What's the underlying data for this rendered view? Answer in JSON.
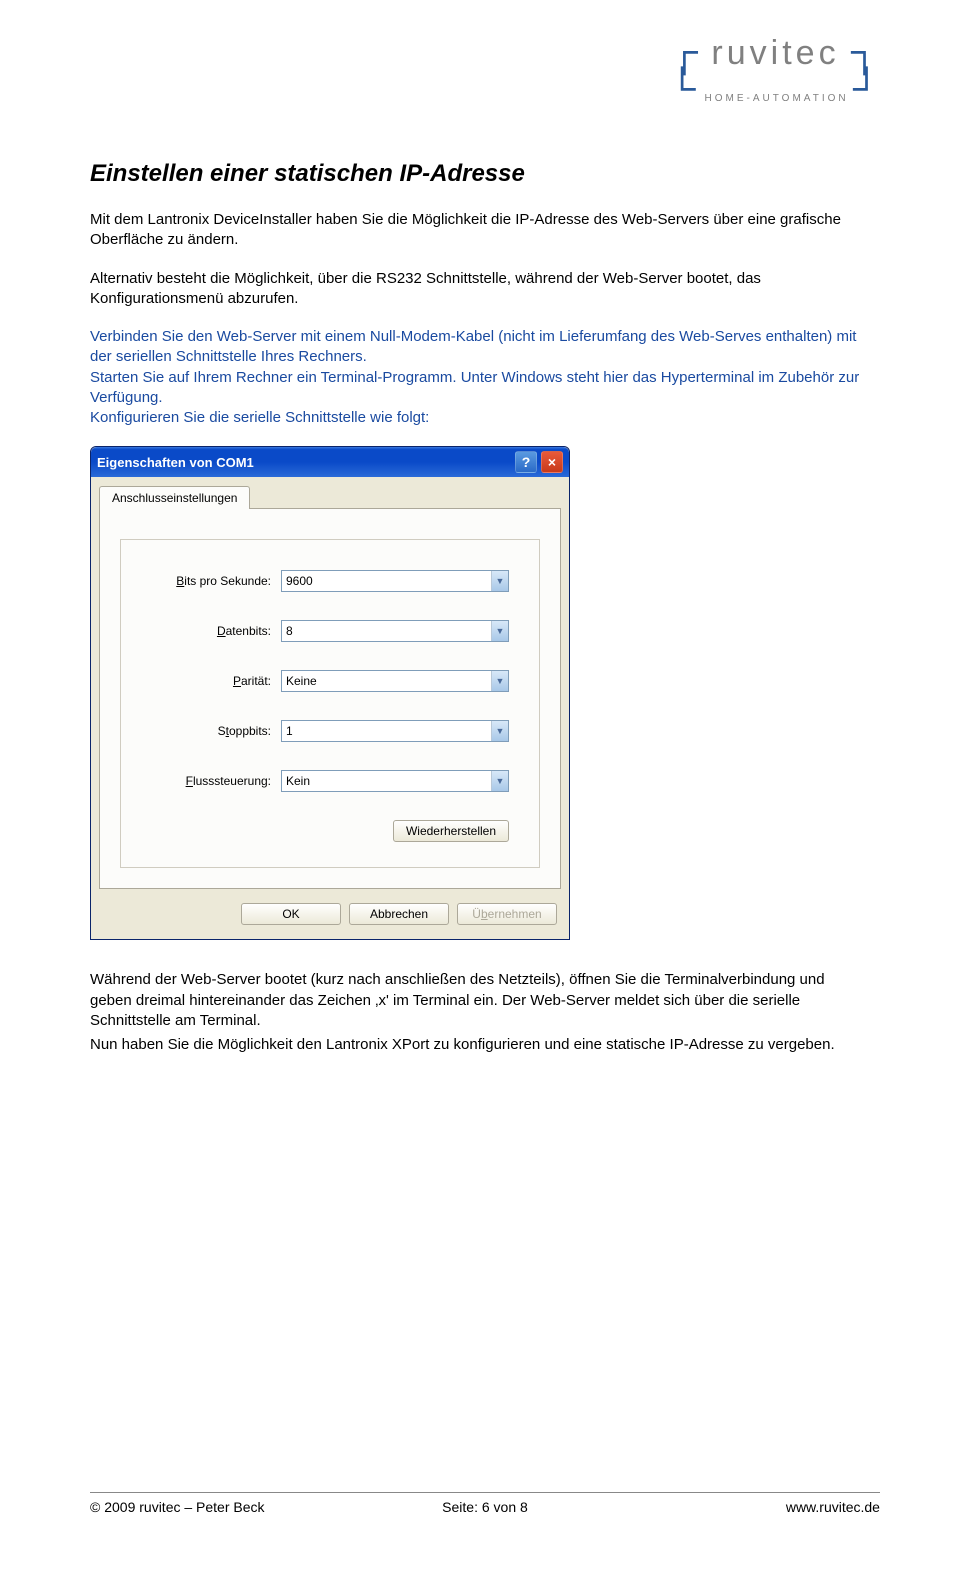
{
  "logo": {
    "name": "ruvitec",
    "tagline": "HOME-AUTOMATION"
  },
  "heading": "Einstellen einer statischen IP-Adresse",
  "para1": "Mit dem Lantronix DeviceInstaller haben Sie die Möglichkeit die IP-Adresse des Web-Servers über eine grafische Oberfläche zu ändern.",
  "para2": "Alternativ besteht die Möglichkeit, über die RS232 Schnittstelle, während der Web-Server bootet, das Konfigurationsmenü abzurufen.",
  "para3a": "Verbinden Sie den Web-Server mit einem Null-Modem-Kabel (nicht im Lieferumfang des Web-Serves enthalten) mit der seriellen Schnittstelle Ihres Rechners.",
  "para3b": "Starten Sie auf Ihrem Rechner ein Terminal-Programm. Unter Windows steht hier das Hyperterminal im Zubehör zur Verfügung.",
  "para3c": "Konfigurieren Sie die serielle Schnittstelle wie folgt:",
  "dialog": {
    "title": "Eigenschaften von COM1",
    "tab": "Anschlusseinstellungen",
    "fields": {
      "bits_label": "Bits pro Sekunde:",
      "bits_value": "9600",
      "datenbits_label": "Datenbits:",
      "datenbits_value": "8",
      "paritaet_label": "Parität:",
      "paritaet_value": "Keine",
      "stoppbits_label": "Stoppbits:",
      "stoppbits_value": "1",
      "fluss_label": "Flusssteuerung:",
      "fluss_value": "Kein"
    },
    "restore": "Wiederherstellen",
    "ok": "OK",
    "cancel": "Abbrechen",
    "apply": "Übernehmen"
  },
  "para4": "Während der Web-Server bootet (kurz nach anschließen des Netzteils), öffnen Sie die Terminalverbindung und geben dreimal hintereinander das Zeichen ‚x' im Terminal ein. Der Web-Server meldet sich über die serielle Schnittstelle am Terminal.",
  "para5": "Nun haben Sie die Möglichkeit den Lantronix XPort zu konfigurieren und eine statische IP-Adresse zu vergeben.",
  "footer": {
    "left": "© 2009 ruvitec – Peter Beck",
    "center": "Seite:  6 von 8",
    "right": "www.ruvitec.de"
  }
}
